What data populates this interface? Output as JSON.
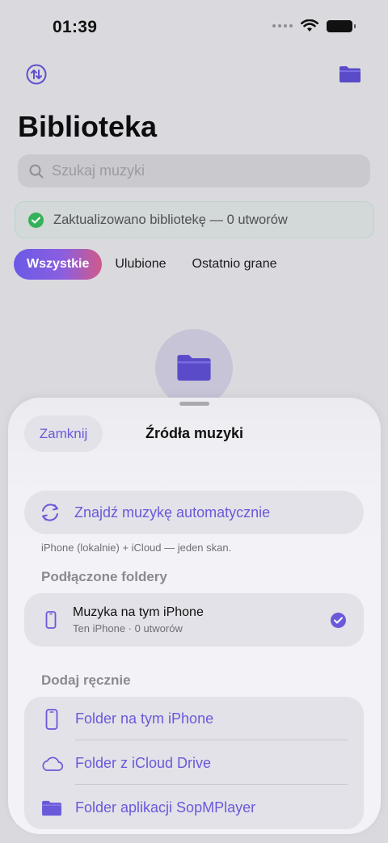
{
  "status": {
    "time": "01:39"
  },
  "library": {
    "title": "Biblioteka",
    "search_placeholder": "Szukaj muzyki",
    "banner_text": "Zaktualizowano bibliotekę — 0 utworów",
    "filters": [
      "Wszystkie",
      "Ulubione",
      "Ostatnio grane"
    ],
    "active_filter": "Wszystkie"
  },
  "sheet": {
    "close_label": "Zamknij",
    "title": "Źródła muzyki",
    "auto_scan_label": "Znajdź muzykę automatycznie",
    "auto_scan_hint": "iPhone (lokalnie) + iCloud — jeden skan.",
    "connected_header": "Podłączone foldery",
    "connected_folders": [
      {
        "name": "Muzyka na tym iPhone",
        "subtitle": "Ten iPhone · 0 utworów",
        "selected": true,
        "icon": "iphone-icon"
      }
    ],
    "manual_header": "Dodaj ręcznie",
    "manual_options": [
      {
        "label": "Folder na tym iPhone",
        "icon": "iphone-icon"
      },
      {
        "label": "Folder z iCloud Drive",
        "icon": "cloud-icon"
      },
      {
        "label": "Folder aplikacji SopMPlayer",
        "icon": "folder-icon"
      }
    ]
  },
  "colors": {
    "accent": "#6a59da",
    "success": "#34b15a"
  }
}
